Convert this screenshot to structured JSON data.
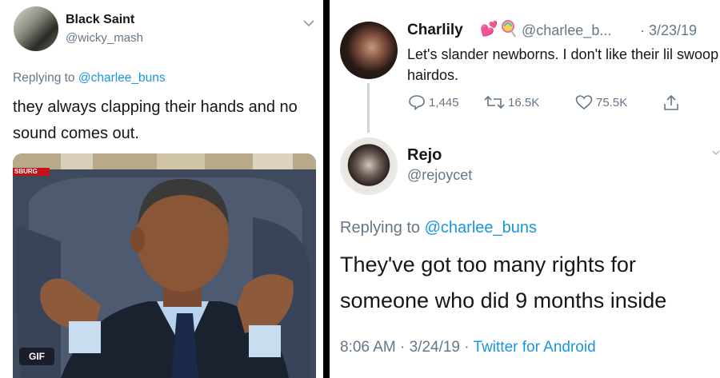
{
  "left_tweet": {
    "display_name": "Black Saint",
    "handle": "@wicky_mash",
    "replying_prefix": "Replying to",
    "replying_handle": "@charlee_buns",
    "text": "they always clapping their hands and no sound comes out.",
    "media": {
      "badge": "GIF",
      "news_tag": "SBURG"
    }
  },
  "right_thread": {
    "original": {
      "display_name": "Charlily",
      "emoji_icons": [
        "sparkling-heart-icon",
        "lollipop-icon"
      ],
      "handle": "@charlee_b...",
      "date": "· 3/23/19",
      "text": "Let's slander newborns. I don't like their lil swoop hairdos.",
      "replies": "1,445",
      "retweets": "16.5K",
      "likes": "75.5K",
      "icons": [
        "reply-icon",
        "retweet-icon",
        "like-icon",
        "share-icon"
      ]
    },
    "reply": {
      "display_name": "Rejo",
      "handle": "@rejoycet",
      "replying_prefix": "Replying to",
      "replying_handle": "@charlee_buns",
      "text": "They've got too many rights for someone who did 9 months inside",
      "timestamp": "8:06 AM · 3/24/19 ·",
      "source": "Twitter for Android"
    }
  },
  "colors": {
    "link": "#1b95e0",
    "muted": "#657786",
    "text": "#14171a",
    "divider": "#000000"
  }
}
